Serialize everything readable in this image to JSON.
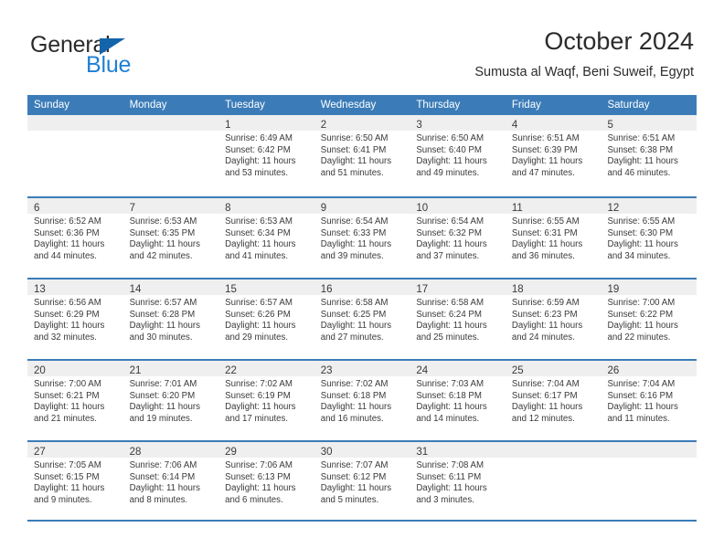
{
  "brand": {
    "word1": "General",
    "word2": "Blue",
    "triangle_color": "#1464aa",
    "blue_color": "#1f7fd4"
  },
  "header": {
    "title": "October 2024",
    "subtitle": "Sumusta al Waqf, Beni Suweif, Egypt"
  },
  "theme": {
    "header_blue": "#3b7cb8",
    "band_gray": "#efefef",
    "text": "#3a3a3a"
  },
  "weekdays": [
    "Sunday",
    "Monday",
    "Tuesday",
    "Wednesday",
    "Thursday",
    "Friday",
    "Saturday"
  ],
  "weeks": [
    [
      {
        "day": "",
        "sunrise": "",
        "sunset": "",
        "daylight1": "",
        "daylight2": ""
      },
      {
        "day": "",
        "sunrise": "",
        "sunset": "",
        "daylight1": "",
        "daylight2": ""
      },
      {
        "day": "1",
        "sunrise": "Sunrise: 6:49 AM",
        "sunset": "Sunset: 6:42 PM",
        "daylight1": "Daylight: 11 hours",
        "daylight2": "and 53 minutes."
      },
      {
        "day": "2",
        "sunrise": "Sunrise: 6:50 AM",
        "sunset": "Sunset: 6:41 PM",
        "daylight1": "Daylight: 11 hours",
        "daylight2": "and 51 minutes."
      },
      {
        "day": "3",
        "sunrise": "Sunrise: 6:50 AM",
        "sunset": "Sunset: 6:40 PM",
        "daylight1": "Daylight: 11 hours",
        "daylight2": "and 49 minutes."
      },
      {
        "day": "4",
        "sunrise": "Sunrise: 6:51 AM",
        "sunset": "Sunset: 6:39 PM",
        "daylight1": "Daylight: 11 hours",
        "daylight2": "and 47 minutes."
      },
      {
        "day": "5",
        "sunrise": "Sunrise: 6:51 AM",
        "sunset": "Sunset: 6:38 PM",
        "daylight1": "Daylight: 11 hours",
        "daylight2": "and 46 minutes."
      }
    ],
    [
      {
        "day": "6",
        "sunrise": "Sunrise: 6:52 AM",
        "sunset": "Sunset: 6:36 PM",
        "daylight1": "Daylight: 11 hours",
        "daylight2": "and 44 minutes."
      },
      {
        "day": "7",
        "sunrise": "Sunrise: 6:53 AM",
        "sunset": "Sunset: 6:35 PM",
        "daylight1": "Daylight: 11 hours",
        "daylight2": "and 42 minutes."
      },
      {
        "day": "8",
        "sunrise": "Sunrise: 6:53 AM",
        "sunset": "Sunset: 6:34 PM",
        "daylight1": "Daylight: 11 hours",
        "daylight2": "and 41 minutes."
      },
      {
        "day": "9",
        "sunrise": "Sunrise: 6:54 AM",
        "sunset": "Sunset: 6:33 PM",
        "daylight1": "Daylight: 11 hours",
        "daylight2": "and 39 minutes."
      },
      {
        "day": "10",
        "sunrise": "Sunrise: 6:54 AM",
        "sunset": "Sunset: 6:32 PM",
        "daylight1": "Daylight: 11 hours",
        "daylight2": "and 37 minutes."
      },
      {
        "day": "11",
        "sunrise": "Sunrise: 6:55 AM",
        "sunset": "Sunset: 6:31 PM",
        "daylight1": "Daylight: 11 hours",
        "daylight2": "and 36 minutes."
      },
      {
        "day": "12",
        "sunrise": "Sunrise: 6:55 AM",
        "sunset": "Sunset: 6:30 PM",
        "daylight1": "Daylight: 11 hours",
        "daylight2": "and 34 minutes."
      }
    ],
    [
      {
        "day": "13",
        "sunrise": "Sunrise: 6:56 AM",
        "sunset": "Sunset: 6:29 PM",
        "daylight1": "Daylight: 11 hours",
        "daylight2": "and 32 minutes."
      },
      {
        "day": "14",
        "sunrise": "Sunrise: 6:57 AM",
        "sunset": "Sunset: 6:28 PM",
        "daylight1": "Daylight: 11 hours",
        "daylight2": "and 30 minutes."
      },
      {
        "day": "15",
        "sunrise": "Sunrise: 6:57 AM",
        "sunset": "Sunset: 6:26 PM",
        "daylight1": "Daylight: 11 hours",
        "daylight2": "and 29 minutes."
      },
      {
        "day": "16",
        "sunrise": "Sunrise: 6:58 AM",
        "sunset": "Sunset: 6:25 PM",
        "daylight1": "Daylight: 11 hours",
        "daylight2": "and 27 minutes."
      },
      {
        "day": "17",
        "sunrise": "Sunrise: 6:58 AM",
        "sunset": "Sunset: 6:24 PM",
        "daylight1": "Daylight: 11 hours",
        "daylight2": "and 25 minutes."
      },
      {
        "day": "18",
        "sunrise": "Sunrise: 6:59 AM",
        "sunset": "Sunset: 6:23 PM",
        "daylight1": "Daylight: 11 hours",
        "daylight2": "and 24 minutes."
      },
      {
        "day": "19",
        "sunrise": "Sunrise: 7:00 AM",
        "sunset": "Sunset: 6:22 PM",
        "daylight1": "Daylight: 11 hours",
        "daylight2": "and 22 minutes."
      }
    ],
    [
      {
        "day": "20",
        "sunrise": "Sunrise: 7:00 AM",
        "sunset": "Sunset: 6:21 PM",
        "daylight1": "Daylight: 11 hours",
        "daylight2": "and 21 minutes."
      },
      {
        "day": "21",
        "sunrise": "Sunrise: 7:01 AM",
        "sunset": "Sunset: 6:20 PM",
        "daylight1": "Daylight: 11 hours",
        "daylight2": "and 19 minutes."
      },
      {
        "day": "22",
        "sunrise": "Sunrise: 7:02 AM",
        "sunset": "Sunset: 6:19 PM",
        "daylight1": "Daylight: 11 hours",
        "daylight2": "and 17 minutes."
      },
      {
        "day": "23",
        "sunrise": "Sunrise: 7:02 AM",
        "sunset": "Sunset: 6:18 PM",
        "daylight1": "Daylight: 11 hours",
        "daylight2": "and 16 minutes."
      },
      {
        "day": "24",
        "sunrise": "Sunrise: 7:03 AM",
        "sunset": "Sunset: 6:18 PM",
        "daylight1": "Daylight: 11 hours",
        "daylight2": "and 14 minutes."
      },
      {
        "day": "25",
        "sunrise": "Sunrise: 7:04 AM",
        "sunset": "Sunset: 6:17 PM",
        "daylight1": "Daylight: 11 hours",
        "daylight2": "and 12 minutes."
      },
      {
        "day": "26",
        "sunrise": "Sunrise: 7:04 AM",
        "sunset": "Sunset: 6:16 PM",
        "daylight1": "Daylight: 11 hours",
        "daylight2": "and 11 minutes."
      }
    ],
    [
      {
        "day": "27",
        "sunrise": "Sunrise: 7:05 AM",
        "sunset": "Sunset: 6:15 PM",
        "daylight1": "Daylight: 11 hours",
        "daylight2": "and 9 minutes."
      },
      {
        "day": "28",
        "sunrise": "Sunrise: 7:06 AM",
        "sunset": "Sunset: 6:14 PM",
        "daylight1": "Daylight: 11 hours",
        "daylight2": "and 8 minutes."
      },
      {
        "day": "29",
        "sunrise": "Sunrise: 7:06 AM",
        "sunset": "Sunset: 6:13 PM",
        "daylight1": "Daylight: 11 hours",
        "daylight2": "and 6 minutes."
      },
      {
        "day": "30",
        "sunrise": "Sunrise: 7:07 AM",
        "sunset": "Sunset: 6:12 PM",
        "daylight1": "Daylight: 11 hours",
        "daylight2": "and 5 minutes."
      },
      {
        "day": "31",
        "sunrise": "Sunrise: 7:08 AM",
        "sunset": "Sunset: 6:11 PM",
        "daylight1": "Daylight: 11 hours",
        "daylight2": "and 3 minutes."
      },
      {
        "day": "",
        "sunrise": "",
        "sunset": "",
        "daylight1": "",
        "daylight2": ""
      },
      {
        "day": "",
        "sunrise": "",
        "sunset": "",
        "daylight1": "",
        "daylight2": ""
      }
    ]
  ]
}
